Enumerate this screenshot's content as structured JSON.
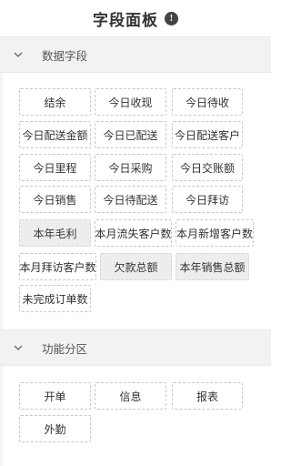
{
  "header": {
    "title": "字段面板",
    "info_icon": "info-icon"
  },
  "sections": {
    "data_fields": {
      "title": "数据字段",
      "items": [
        {
          "label": "结余",
          "active": true
        },
        {
          "label": "今日收现",
          "active": false
        },
        {
          "label": "今日待收",
          "active": false
        },
        {
          "label": "今日配送金额",
          "active": false
        },
        {
          "label": "今日已配送",
          "active": false
        },
        {
          "label": "今日配送客户",
          "active": false
        },
        {
          "label": "今日里程",
          "active": false
        },
        {
          "label": "今日采购",
          "active": false
        },
        {
          "label": "今日交账额",
          "active": false
        },
        {
          "label": "今日销售",
          "active": false
        },
        {
          "label": "今日待配送",
          "active": false
        },
        {
          "label": "今日拜访",
          "active": false
        },
        {
          "label": "本年毛利",
          "active": true
        },
        {
          "label": "本月流失客户数",
          "active": false
        },
        {
          "label": "本月新增客户数",
          "active": false
        },
        {
          "label": "本月拜访客户数",
          "active": false
        },
        {
          "label": "欠款总额",
          "active": true
        },
        {
          "label": "本年销售总额",
          "active": true
        },
        {
          "label": "未完成订单数",
          "active": false
        }
      ]
    },
    "function_zones": {
      "title": "功能分区",
      "items": [
        {
          "label": "开单",
          "active": false
        },
        {
          "label": "信息",
          "active": false
        },
        {
          "label": "报表",
          "active": false
        },
        {
          "label": "外勤",
          "active": false
        }
      ]
    }
  }
}
